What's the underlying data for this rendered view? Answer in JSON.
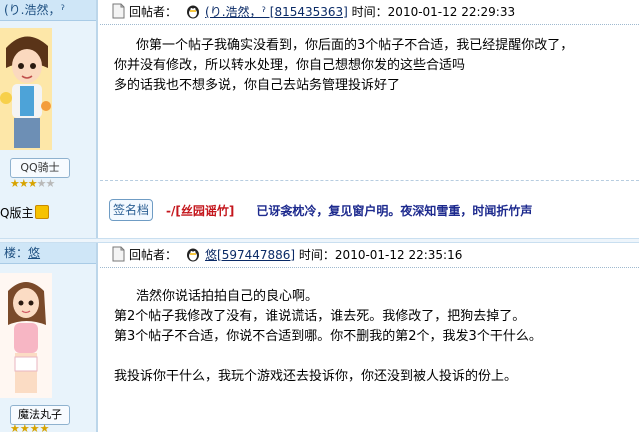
{
  "post1": {
    "user_header": "(り.浩然，ˀ",
    "rank": "QQ骑士",
    "moderator": "Q版主",
    "stars_on": 3,
    "stars_total": 5,
    "header": {
      "poster_label": "回帖者：",
      "poster_name": "(り.浩然，ˀ [815435363]",
      "time": "时间：2010-01-12 22:29:33"
    },
    "content": [
      "你第一个帖子我确实没看到，你后面的3个帖子不合适，我已经提醒你改了，",
      "你并没有修改，所以转水处理，你自己想想你发的这些合适吗",
      "多的话我也不想多说，你自己去站务管理投诉好了"
    ],
    "signature_button": "签名档",
    "signature_red": "-/[丝园谣竹]",
    "signature_blue": "已讶衾枕冷，复见窗户明。夜深知雪重，时闻折竹声"
  },
  "post2": {
    "user_header_prefix": "楼：",
    "user_header_name": "悠",
    "rank": "魔法丸子",
    "header": {
      "poster_label": "回帖者：",
      "poster_name": "悠[597447886]",
      "time": "时间：2010-01-12 22:35:16"
    },
    "content": [
      "浩然你说话拍拍自己的良心啊。",
      "第2个帖子我修改了没有，谁说谎话，谁去死。我修改了，把狗去掉了。",
      "第3个帖子不合适，你说不合适到哪。你不删我的第2个，我发3个干什么。",
      "",
      "我投诉你干什么，我玩个游戏还去投诉你，你还没到被人投诉的份上。"
    ]
  },
  "colors": {
    "panel_bg": "#e8f3fb",
    "header_bg": "#cfe6f7",
    "signature_red": "#c4161c",
    "signature_blue": "#1d2a8e"
  }
}
